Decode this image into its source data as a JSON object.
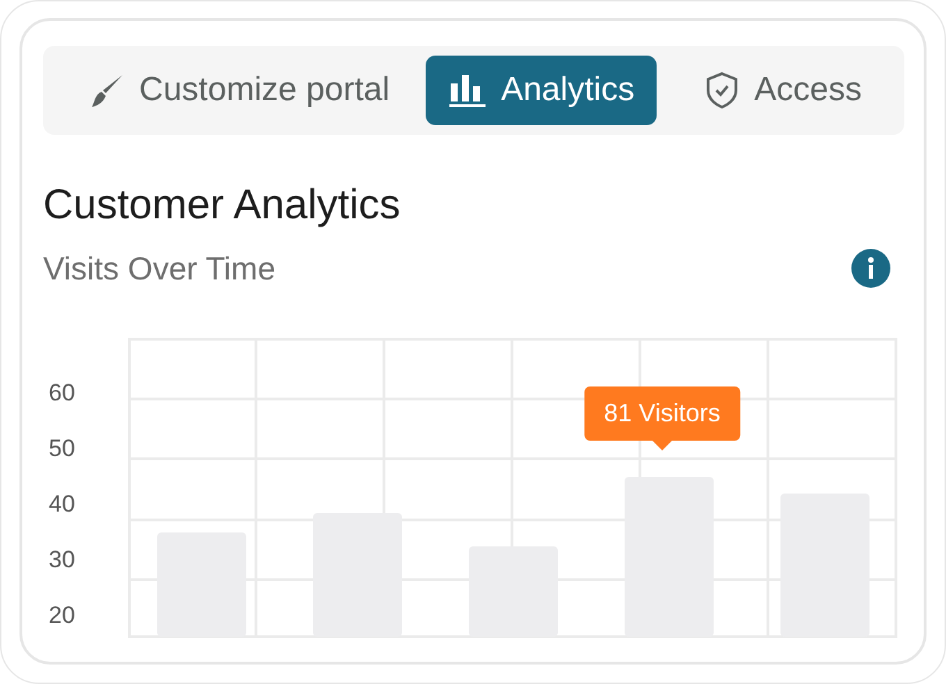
{
  "tabs": [
    {
      "label": "Customize portal",
      "kind": "brush",
      "selected": false
    },
    {
      "label": "Analytics",
      "kind": "bars",
      "selected": true
    },
    {
      "label": "Access",
      "kind": "shield",
      "selected": false
    }
  ],
  "title": "Customer Analytics",
  "subtitle": "Visits Over Time",
  "chart": {
    "tooltip": {
      "text": "81 Visitors"
    },
    "chart_data": {
      "type": "bar",
      "values": [
        35,
        38.5,
        32.5,
        45,
        42
      ],
      "ylim": [
        16,
        70
      ],
      "yticks": [
        20,
        30,
        40,
        50,
        60
      ]
    }
  }
}
